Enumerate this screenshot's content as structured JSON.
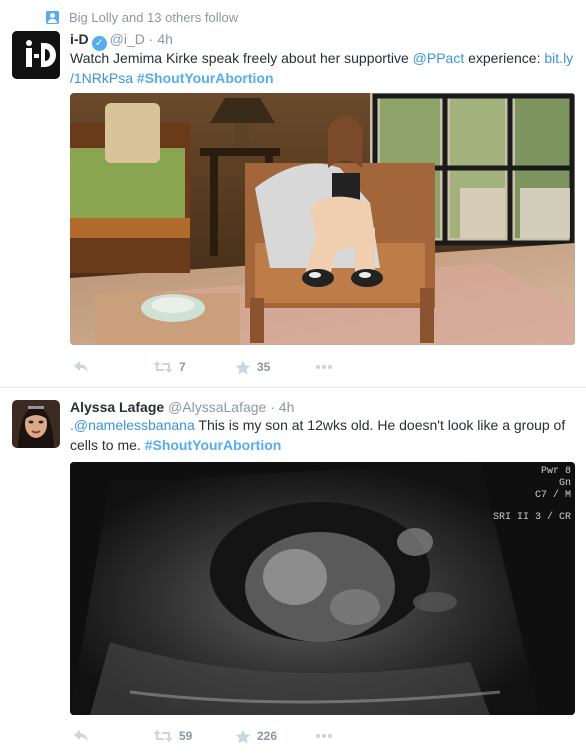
{
  "tweet1": {
    "context": "Big Lolly and 13 others follow",
    "name": "i-D",
    "handle": "@i_D",
    "time": "4h",
    "text_a": "Watch Jemima Kirke speak freely about her supportive ",
    "mention": "@PPact",
    "text_b": " experience: ",
    "link_a": "bit.ly",
    "link_b": "/1NRkPsa",
    "hashtag": "#ShoutYourAbortion",
    "retweets": "7",
    "favorites": "35"
  },
  "tweet2": {
    "name": "Alyssa Lafage",
    "handle": "@AlyssaLafage",
    "time": "4h",
    "reply_to": ".@namelessbanana",
    "text": " This is my son at 12wks old. He doesn't look like a group of cells to me. ",
    "hashtag": "#ShoutYourAbortion",
    "retweets": "59",
    "favorites": "226",
    "ultrasound_labels": [
      "Pwr 8",
      "Gn",
      "C7 / M",
      "SRI II 3 / CR"
    ]
  },
  "icons": {
    "reply": "reply-icon",
    "retweet": "retweet-icon",
    "favorite": "star-icon",
    "more": "more-icon",
    "verified": "verified-badge-icon",
    "context": "person-icon"
  },
  "colors": {
    "link": "#3b94d9",
    "hashtag": "#55acee",
    "muted": "#8899a6",
    "text": "#292f33"
  }
}
